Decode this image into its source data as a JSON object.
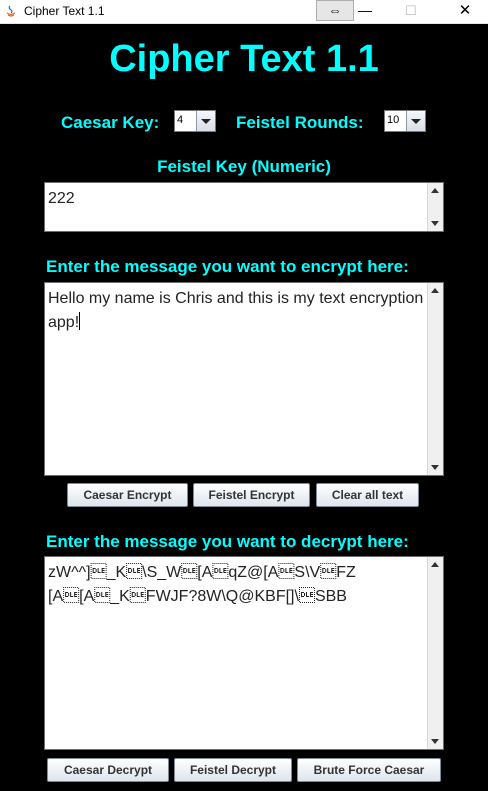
{
  "window": {
    "title": "Cipher Text 1.1",
    "restore_glyph": "⇔",
    "min_glyph": "—",
    "max_glyph": "☐",
    "close_glyph": "✕"
  },
  "header": {
    "title": "Cipher Text 1.1"
  },
  "controls": {
    "caesar_key_label": "Caesar Key:",
    "caesar_key_value": "4",
    "feistel_rounds_label": "Feistel Rounds:",
    "feistel_rounds_value": "10",
    "feistel_key_label": "Feistel Key (Numeric)",
    "feistel_key_value": "222"
  },
  "encrypt": {
    "label": "Enter the message you want to encrypt here:",
    "text": "Hello my name is Chris and this is my text encryption app!",
    "buttons": [
      "Caesar Encrypt",
      "Feistel Encrypt",
      "Clear all text"
    ]
  },
  "decrypt": {
    "label": "Enter the message you want to decrypt here:",
    "text": "zW^^]\u0010_K\u0010\\S_W\u0010[A\u0010qZ@[A\u0010S\\V\u0010FZ[A\u0010[A\u0010_K\u0010FWJF?8W\\Q@KBF[]\\\u0010SBB",
    "buttons": [
      "Caesar Decrypt",
      "Feistel Decrypt",
      "Brute Force Caesar"
    ]
  },
  "colors": {
    "background": "#000000",
    "accent": "#00ffff"
  }
}
